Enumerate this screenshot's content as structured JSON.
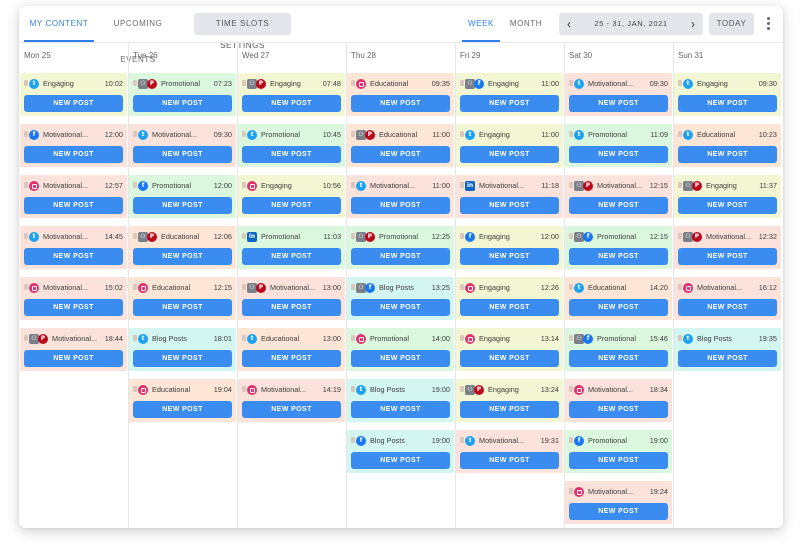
{
  "tabs": {
    "my_content": "MY CONTENT",
    "upcoming_events": "UPCOMING EVENTS",
    "time_slots_settings": "TIME SLOTS SETTINGS"
  },
  "view_toggle": {
    "week": "WEEK",
    "month": "MONTH",
    "active": "week"
  },
  "date_nav": {
    "prev": "‹",
    "range": "25 - 31, JAN, 2021",
    "next": "›"
  },
  "today_label": "TODAY",
  "colors": {
    "accent": "#2f80ed",
    "button": "#3b8cf0",
    "engaging": "#f2f6d2",
    "promotional": "#dbf8de",
    "educational": "#fde6d6",
    "motivational": "#fbe3dc",
    "blog_posts": "#d4f6f1"
  },
  "new_post_label": "NEW POST",
  "days": [
    {
      "name": "Mon 25",
      "slots": [
        {
          "icons": [
            "twitter"
          ],
          "title": "Engaging",
          "time": "10:02",
          "cat": "engaging"
        },
        {
          "icons": [
            "facebook"
          ],
          "title": "Motivational...",
          "time": "12:00",
          "cat": "motivational"
        },
        {
          "icons": [
            "instagram"
          ],
          "title": "Motivational...",
          "time": "12:57",
          "cat": "motivational"
        },
        {
          "icons": [
            "twitter"
          ],
          "title": "Motivational...",
          "time": "14:45",
          "cat": "motivational"
        },
        {
          "icons": [
            "instagram"
          ],
          "title": "Motivational...",
          "time": "15:02",
          "cat": "motivational"
        },
        {
          "icons": [
            "group",
            "pinterest"
          ],
          "title": "Motivational...",
          "time": "18:44",
          "cat": "motivational"
        }
      ]
    },
    {
      "name": "Tue 26",
      "slots": [
        {
          "icons": [
            "group",
            "pinterest"
          ],
          "title": "Promotional",
          "time": "07:23",
          "cat": "promotional"
        },
        {
          "icons": [
            "twitter"
          ],
          "title": "Motivational...",
          "time": "09:30",
          "cat": "motivational"
        },
        {
          "icons": [
            "facebook"
          ],
          "title": "Promotional",
          "time": "12:00",
          "cat": "promotional"
        },
        {
          "icons": [
            "group",
            "pinterest"
          ],
          "title": "Educational",
          "time": "12:06",
          "cat": "educational"
        },
        {
          "icons": [
            "instagram"
          ],
          "title": "Educational",
          "time": "12:15",
          "cat": "educational"
        },
        {
          "icons": [
            "twitter"
          ],
          "title": "Blog Posts",
          "time": "18:01",
          "cat": "blog_posts"
        },
        {
          "icons": [
            "instagram"
          ],
          "title": "Educational",
          "time": "19:04",
          "cat": "educational"
        }
      ]
    },
    {
      "name": "Wed 27",
      "slots": [
        {
          "icons": [
            "group",
            "pinterest"
          ],
          "title": "Engaging",
          "time": "07:48",
          "cat": "engaging"
        },
        {
          "icons": [
            "twitter"
          ],
          "title": "Promotional",
          "time": "10:45",
          "cat": "promotional"
        },
        {
          "icons": [
            "instagram"
          ],
          "title": "Engaging",
          "time": "10:56",
          "cat": "engaging"
        },
        {
          "icons": [
            "linkedin"
          ],
          "title": "Promotional",
          "time": "11:03",
          "cat": "promotional"
        },
        {
          "icons": [
            "group",
            "pinterest"
          ],
          "title": "Motivational...",
          "time": "13:00",
          "cat": "motivational"
        },
        {
          "icons": [
            "twitter"
          ],
          "title": "Educational",
          "time": "13:00",
          "cat": "educational"
        },
        {
          "icons": [
            "instagram"
          ],
          "title": "Motivational...",
          "time": "14:19",
          "cat": "motivational"
        }
      ]
    },
    {
      "name": "Thu 28",
      "slots": [
        {
          "icons": [
            "instagram"
          ],
          "title": "Educational",
          "time": "09:35",
          "cat": "educational"
        },
        {
          "icons": [
            "group",
            "pinterest"
          ],
          "title": "Educational",
          "time": "11:00",
          "cat": "educational"
        },
        {
          "icons": [
            "twitter"
          ],
          "title": "Motivational...",
          "time": "11:00",
          "cat": "motivational"
        },
        {
          "icons": [
            "group",
            "pinterest"
          ],
          "title": "Promotional",
          "time": "12:25",
          "cat": "promotional"
        },
        {
          "icons": [
            "group",
            "facebook"
          ],
          "title": "Blog Posts",
          "time": "13:25",
          "cat": "blog_posts"
        },
        {
          "icons": [
            "instagram"
          ],
          "title": "Promotional",
          "time": "14:00",
          "cat": "promotional"
        },
        {
          "icons": [
            "twitter"
          ],
          "title": "Blog Posts",
          "time": "19:00",
          "cat": "blog_posts"
        },
        {
          "icons": [
            "facebook"
          ],
          "title": "Blog Posts",
          "time": "19:00",
          "cat": "blog_posts"
        }
      ]
    },
    {
      "name": "Fri 29",
      "slots": [
        {
          "icons": [
            "group",
            "facebook"
          ],
          "title": "Engaging",
          "time": "11:00",
          "cat": "engaging"
        },
        {
          "icons": [
            "twitter"
          ],
          "title": "Engaging",
          "time": "11:00",
          "cat": "engaging"
        },
        {
          "icons": [
            "linkedin"
          ],
          "title": "Motivational...",
          "time": "11:18",
          "cat": "motivational"
        },
        {
          "icons": [
            "facebook"
          ],
          "title": "Engaging",
          "time": "12:00",
          "cat": "engaging"
        },
        {
          "icons": [
            "instagram"
          ],
          "title": "Engaging",
          "time": "12:26",
          "cat": "engaging"
        },
        {
          "icons": [
            "instagram"
          ],
          "title": "Engaging",
          "time": "13:14",
          "cat": "engaging"
        },
        {
          "icons": [
            "group",
            "pinterest"
          ],
          "title": "Engaging",
          "time": "13:24",
          "cat": "engaging"
        },
        {
          "icons": [
            "twitter"
          ],
          "title": "Motivational...",
          "time": "19:31",
          "cat": "motivational"
        }
      ]
    },
    {
      "name": "Sat 30",
      "slots": [
        {
          "icons": [
            "twitter"
          ],
          "title": "Motivational...",
          "time": "09:30",
          "cat": "motivational"
        },
        {
          "icons": [
            "twitter"
          ],
          "title": "Promotional",
          "time": "11:09",
          "cat": "promotional"
        },
        {
          "icons": [
            "group",
            "pinterest"
          ],
          "title": "Motivational...",
          "time": "12:15",
          "cat": "motivational"
        },
        {
          "icons": [
            "group",
            "facebook"
          ],
          "title": "Promotional",
          "time": "12:15",
          "cat": "promotional"
        },
        {
          "icons": [
            "twitter"
          ],
          "title": "Educational",
          "time": "14:20",
          "cat": "educational"
        },
        {
          "icons": [
            "group",
            "facebook"
          ],
          "title": "Promotional",
          "time": "15:46",
          "cat": "promotional"
        },
        {
          "icons": [
            "instagram"
          ],
          "title": "Motivational...",
          "time": "18:34",
          "cat": "motivational"
        },
        {
          "icons": [
            "facebook"
          ],
          "title": "Promotional",
          "time": "19:00",
          "cat": "promotional"
        },
        {
          "icons": [
            "instagram"
          ],
          "title": "Motivational...",
          "time": "19:24",
          "cat": "motivational"
        }
      ]
    },
    {
      "name": "Sun 31",
      "slots": [
        {
          "icons": [
            "twitter"
          ],
          "title": "Engaging",
          "time": "09:30",
          "cat": "engaging"
        },
        {
          "icons": [
            "twitter"
          ],
          "title": "Educational",
          "time": "10:23",
          "cat": "educational"
        },
        {
          "icons": [
            "group",
            "pinterest"
          ],
          "title": "Engaging",
          "time": "11:37",
          "cat": "engaging"
        },
        {
          "icons": [
            "group",
            "pinterest"
          ],
          "title": "Motivational...",
          "time": "12:32",
          "cat": "motivational"
        },
        {
          "icons": [
            "instagram"
          ],
          "title": "Motivational...",
          "time": "16:12",
          "cat": "motivational"
        },
        {
          "icons": [
            "twitter"
          ],
          "title": "Blog Posts",
          "time": "19:35",
          "cat": "blog_posts"
        }
      ]
    }
  ]
}
